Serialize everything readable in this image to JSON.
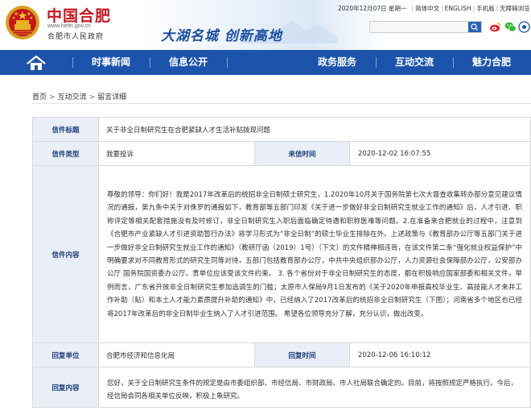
{
  "header": {
    "site_name": "中国合肥",
    "site_url": "www.hefei.gov.cn",
    "site_sub": "合肥市人民政府",
    "slogan": "大湖名城  创新高地",
    "date": "2020年12月07日 星期一",
    "links": [
      "简体中文",
      "ENGLISH",
      "手机版",
      "无障碍浏览"
    ],
    "search_placeholder": "",
    "colors": {
      "brand_red": "#c8161d",
      "nav_blue": "#1d54ab"
    }
  },
  "nav": {
    "items": [
      "时事新闻",
      "信息公开",
      "政务服务",
      "互动交流",
      "魅力合肥"
    ]
  },
  "breadcrumb": [
    "首页",
    "互动交流",
    "留言详细"
  ],
  "message": {
    "title_label": "信件标题",
    "title": "关于非全日制研究生在合肥紧缺人才生活补贴拨现问题",
    "type_label": "信件类型",
    "type": "我要投诉",
    "sent_label": "来信时间",
    "sent_time": "2020-12-02 16:07:55",
    "content_label": "信件内容",
    "content": "尊敬的领导：你们好！我是2017年改革后的统招非全日制硕士研究生，1.2020年10月关于国务院第七次大督查收集转办部分意见建议情况的通报，第九条中关于对侏罗的通报如下，教育部等五部门印发《关于进一步做好非全日制研究生就业工作的通知》后，人才引进、职称评定等相关配套措施没有及时修订，非全日制研究生入职后面临确定待遇和职称医难等问题。2.在准备来合肥就业的过程中，注意到《合肥市产业紧缺人才引进资助暂行办法》将学习形式为“非全日制”的硕士毕业生排除在外。上述政策与《教育部办公厅等五部门关于进一步做好非全日制研究生就业工作的通知》（教研厅函（2019）1号）（下文）的文件精神相违背，在该文件第二条“强化就业权益保护”中明确要求对不同教育形式的研究生同等对待，五部门包括教育部办公厅，中共中央组织部办公厅，人力资源社会保障部办公厅，公安部办公厅 国务院国资委办公厅。贵单位应该受该文件约束。 3. 各个省份对于非全日制研究生的态度，都在积极响应国家部委和相关文件。举例而言，广东省开放非全日制研究生参加选调生的门槛；太原市人保局9月1日发布的《关于2020年申报高校毕业生、高技能人才来并工作补助（贴）和本土人才能力素质提升补助的通知》中，已经纳入了2017改革后的统招非全日制研究生（下图）；河南省多个地区也已经将2017年改革后的非全日制毕业生纳入了人才引进范围。 希望各位领导充分了解，充分认识，做出改变。",
    "reply_unit_label": "回复单位",
    "reply_unit": "合肥市经济和信息化局",
    "reply_time_label": "回复时间",
    "reply_time": "2020-12-06 16:10:12",
    "reply_content_label": "回复内容",
    "reply_content": "您好，关于全日制研究生条件的规定是由市委组织部、市经信局、市财政局、市人社局联合确定的。目前，将按照规定严格执行。今后，经信局会同各相关单位反映，积极上象研究。"
  }
}
